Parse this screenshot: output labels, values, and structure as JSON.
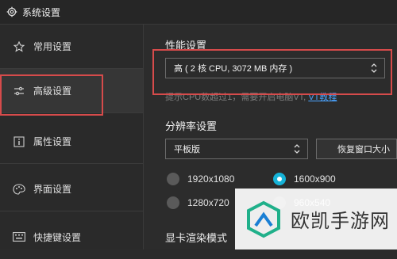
{
  "window": {
    "title": "系统设置"
  },
  "sidebar": {
    "items": [
      {
        "label": "常用设置",
        "icon": "star-icon"
      },
      {
        "label": "高级设置",
        "icon": "sliders-icon",
        "active": true
      },
      {
        "label": "属性设置",
        "icon": "info-icon"
      },
      {
        "label": "界面设置",
        "icon": "palette-icon"
      },
      {
        "label": "快捷键设置",
        "icon": "keyboard-icon"
      }
    ]
  },
  "performance": {
    "title": "性能设置",
    "selected": "高 ( 2 核 CPU, 3072 MB 内存 )",
    "hint_text": "提示CPU数超过1，需要开启电脑VT,",
    "hint_link": "VT教程"
  },
  "resolution": {
    "title": "分辨率设置",
    "mode_selected": "平板版",
    "restore_button": "恢复窗口大小",
    "options": [
      {
        "label": "1920x1080",
        "selected": false
      },
      {
        "label": "1600x900",
        "selected": true
      },
      {
        "label": "1280x720",
        "selected": false
      },
      {
        "label": "960x540",
        "selected": false
      }
    ]
  },
  "render": {
    "title": "显卡渲染模式"
  },
  "watermark": {
    "text": "欧凯手游网"
  },
  "colors": {
    "accent": "#16b3d8",
    "highlight": "#d64b4b",
    "link": "#4aa3ff"
  }
}
